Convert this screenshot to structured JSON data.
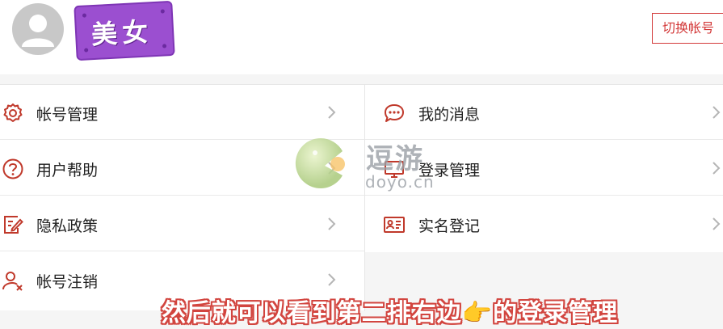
{
  "header": {
    "nickname": "美女",
    "switch_label": "切换帐号"
  },
  "menu": {
    "left": [
      {
        "label": "帐号管理",
        "icon": "gear-icon"
      },
      {
        "label": "用户帮助",
        "icon": "question-icon"
      },
      {
        "label": "隐私政策",
        "icon": "policy-edit-icon"
      },
      {
        "label": "帐号注销",
        "icon": "user-remove-icon"
      }
    ],
    "right": [
      {
        "label": "我的消息",
        "icon": "chat-bubble-icon"
      },
      {
        "label": "登录管理",
        "icon": "login-device-icon"
      },
      {
        "label": "实名登记",
        "icon": "id-card-icon"
      }
    ]
  },
  "watermark": {
    "cn": "逗游",
    "en": "doyo.cn"
  },
  "caption": {
    "before": "然后就可以看到第二排右边",
    "emoji": "👉",
    "after": "的登录管理"
  },
  "colors": {
    "accent": "#d33a3a",
    "icon": "#c0392b",
    "tag": "#9b4fd0",
    "chevron": "#b5b5b5"
  }
}
